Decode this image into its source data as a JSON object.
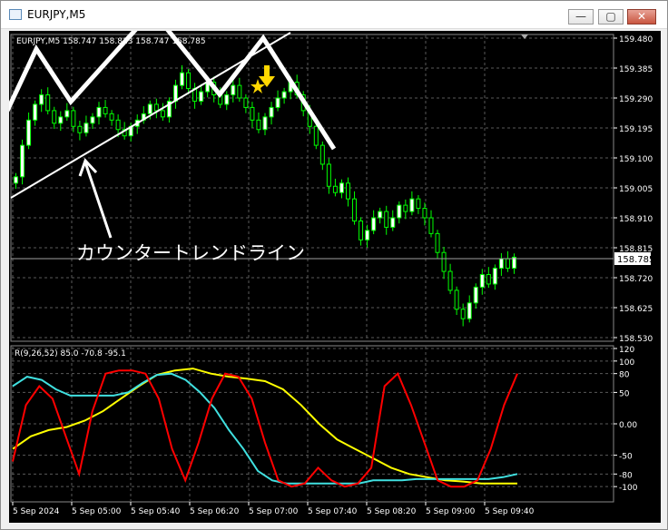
{
  "window": {
    "title": "EURJPY,M5",
    "icon": "chart-window-icon",
    "buttons": {
      "minimize": "—",
      "maximize": "▢",
      "close": "✕"
    }
  },
  "colors": {
    "background": "#000000",
    "grid": "#5a5a5a",
    "axis_text": "#ffffff",
    "candle": "#00ff00",
    "candle_up_body": "#ffffff",
    "current_price_line": "#a0a0a0",
    "price_tag_bg": "#ffffff",
    "annotation": "#ffffff",
    "marker": "#ffd700",
    "osc_red": "#ff0000",
    "osc_cyan": "#40e0e0",
    "osc_yellow": "#ffff00"
  },
  "main_panel": {
    "header": "EURJPY,M5  158.747 158.813 158.747 158.785",
    "current_price": "158.785",
    "annotation_text": "カウンタートレンドライン",
    "marker_icon": "star-arrow-icon",
    "y_ticks": [
      "159.480",
      "159.385",
      "159.290",
      "159.195",
      "159.100",
      "159.005",
      "158.910",
      "158.815",
      "158.720",
      "158.625",
      "158.530"
    ]
  },
  "osc_panel": {
    "header": "R(9,26,52) 85.0 -70.8 -95.1",
    "y_ticks": [
      "120",
      "100",
      "80",
      "50",
      "0.00",
      "-50",
      "-80",
      "-100"
    ]
  },
  "x_ticks": [
    "5 Sep 2024",
    "5 Sep 05:00",
    "5 Sep 05:40",
    "5 Sep 06:20",
    "5 Sep 07:00",
    "5 Sep 07:40",
    "5 Sep 08:20",
    "5 Sep 09:00",
    "5 Sep 09:40"
  ],
  "chart_data": {
    "type": "candlestick",
    "symbol": "EURJPY",
    "timeframe": "M5",
    "last_ohlc": {
      "open": 158.747,
      "high": 158.813,
      "low": 158.747,
      "close": 158.785
    },
    "price_range": [
      158.53,
      159.48
    ],
    "candles_close": [
      159.04,
      159.14,
      159.22,
      159.27,
      159.3,
      159.25,
      159.21,
      159.23,
      159.25,
      159.2,
      159.18,
      159.21,
      159.23,
      159.26,
      159.24,
      159.22,
      159.19,
      159.17,
      159.2,
      159.22,
      159.24,
      159.27,
      159.25,
      159.23,
      159.28,
      159.33,
      159.37,
      159.32,
      159.28,
      159.31,
      159.34,
      159.3,
      159.27,
      159.3,
      159.33,
      159.29,
      159.26,
      159.22,
      159.19,
      159.23,
      159.26,
      159.29,
      159.31,
      159.34,
      159.3,
      159.25,
      159.2,
      159.14,
      159.08,
      159.01,
      158.99,
      159.02,
      158.97,
      158.9,
      158.84,
      158.87,
      158.91,
      158.93,
      158.88,
      158.91,
      158.95,
      158.93,
      158.97,
      158.94,
      158.91,
      158.86,
      158.8,
      158.74,
      158.68,
      158.62,
      158.59,
      158.64,
      158.69,
      158.73,
      158.7,
      158.75,
      158.78,
      158.75,
      158.785
    ],
    "oscillator": {
      "name": "R(9,26,52)",
      "values_last": [
        85.0,
        -70.8,
        -95.1
      ],
      "range": [
        -120,
        120
      ],
      "red": [
        -60,
        30,
        60,
        40,
        -20,
        -80,
        20,
        80,
        85,
        85,
        80,
        40,
        -40,
        -90,
        -30,
        40,
        80,
        75,
        40,
        -30,
        -90,
        -100,
        -95,
        -70,
        -90,
        -100,
        -95,
        -70,
        60,
        80,
        30,
        -30,
        -90,
        -100,
        -100,
        -90,
        -40,
        30,
        80
      ],
      "cyan": [
        60,
        75,
        70,
        55,
        45,
        45,
        45,
        45,
        50,
        65,
        78,
        80,
        70,
        50,
        25,
        -10,
        -40,
        -75,
        -90,
        -95,
        -95,
        -95,
        -95,
        -95,
        -95,
        -90,
        -90,
        -90,
        -88,
        -88,
        -88,
        -88,
        -88,
        -88,
        -85,
        -80
      ],
      "yellow": [
        -40,
        -20,
        -10,
        -5,
        5,
        20,
        40,
        60,
        78,
        85,
        88,
        80,
        75,
        72,
        68,
        55,
        30,
        0,
        -25,
        -40,
        -55,
        -70,
        -80,
        -85,
        -90,
        -92,
        -95,
        -95,
        -95
      ]
    }
  }
}
